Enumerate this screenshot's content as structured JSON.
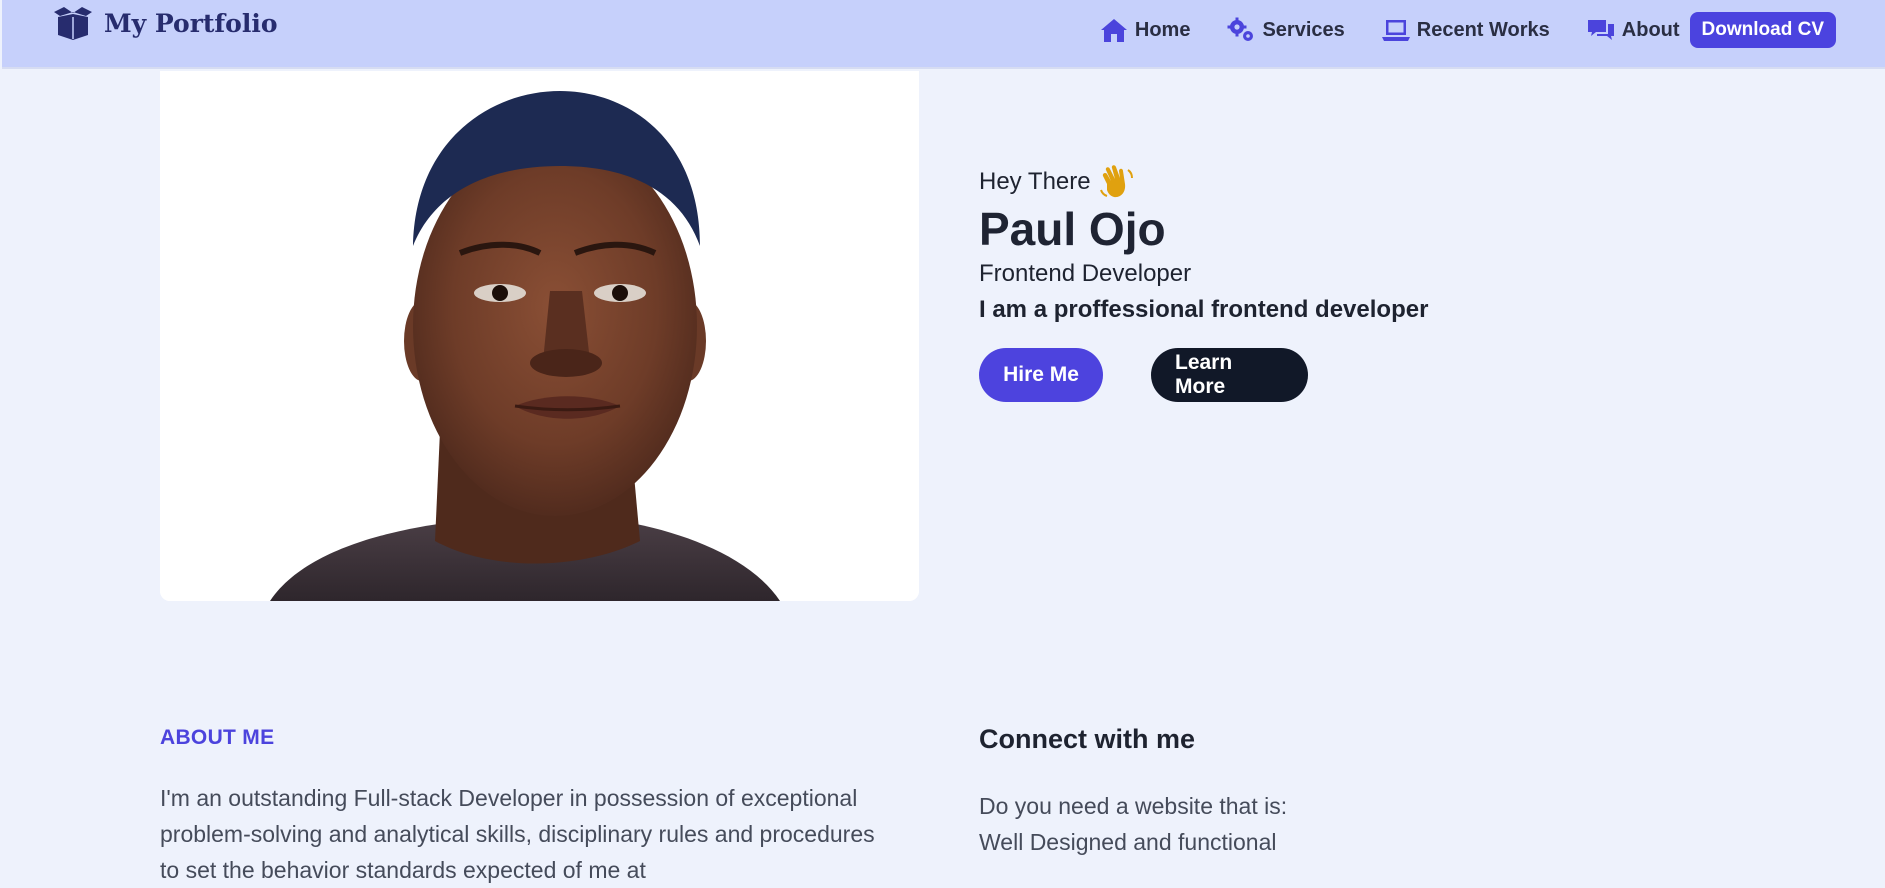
{
  "brand": {
    "name": "My Portfolio",
    "icon": "open-box-icon"
  },
  "nav": {
    "items": [
      {
        "label": "Home",
        "icon": "home-icon"
      },
      {
        "label": "Services",
        "icon": "gears-icon"
      },
      {
        "label": "Recent Works",
        "icon": "laptop-icon"
      },
      {
        "label": "About",
        "icon": "chat-bubbles-icon"
      }
    ],
    "download_cv": "Download CV"
  },
  "hero": {
    "greeting": "Hey There",
    "greeting_icon": "waving-hand-icon",
    "name": "Paul Ojo",
    "role": "Frontend Developer",
    "pitch": "I am a proffessional frontend developer",
    "hire_label": "Hire Me",
    "learn_label": "Learn More"
  },
  "about": {
    "label": "ABOUT ME",
    "text": "I'm an outstanding Full-stack Developer in possession of exceptional problem-solving and analytical skills, disciplinary rules and procedures to set the behavior standards expected of me at"
  },
  "connect": {
    "title": "Connect with me",
    "line1": "Do you need a website that is:",
    "line2": "Well Designed and functional"
  },
  "colors": {
    "accent": "#4b43df",
    "navbar_bg": "#c6d0fb",
    "page_bg": "#eef2fc",
    "dark_button": "#111828"
  }
}
